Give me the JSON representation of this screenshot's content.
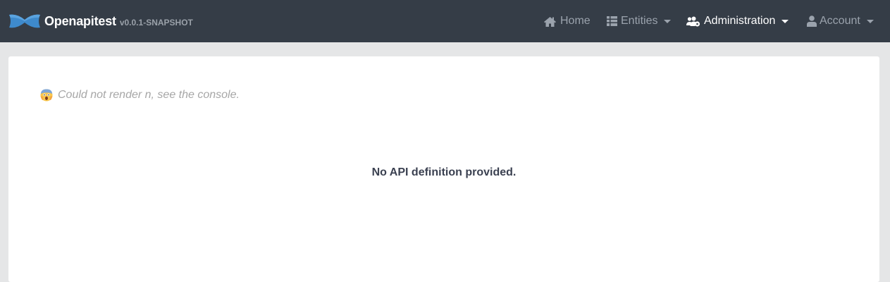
{
  "brand": {
    "title": "Openapitest",
    "version": "v0.0.1-SNAPSHOT"
  },
  "nav": {
    "home": {
      "label": "Home",
      "icon": "home-icon"
    },
    "entities": {
      "label": "Entities",
      "icon": "table-icon"
    },
    "administration": {
      "label": "Administration",
      "icon": "users-cog-icon"
    },
    "account": {
      "label": "Account",
      "icon": "user-icon"
    }
  },
  "main": {
    "error_message": "Could not render n, see the console.",
    "no_api_message": "No API definition provided."
  },
  "colors": {
    "navbar_bg": "#353d47",
    "nav_text": "#9ba3ad",
    "nav_active_text": "#ffffff",
    "page_bg": "#e5e6e7",
    "logo_blue": "#3e8acc"
  }
}
